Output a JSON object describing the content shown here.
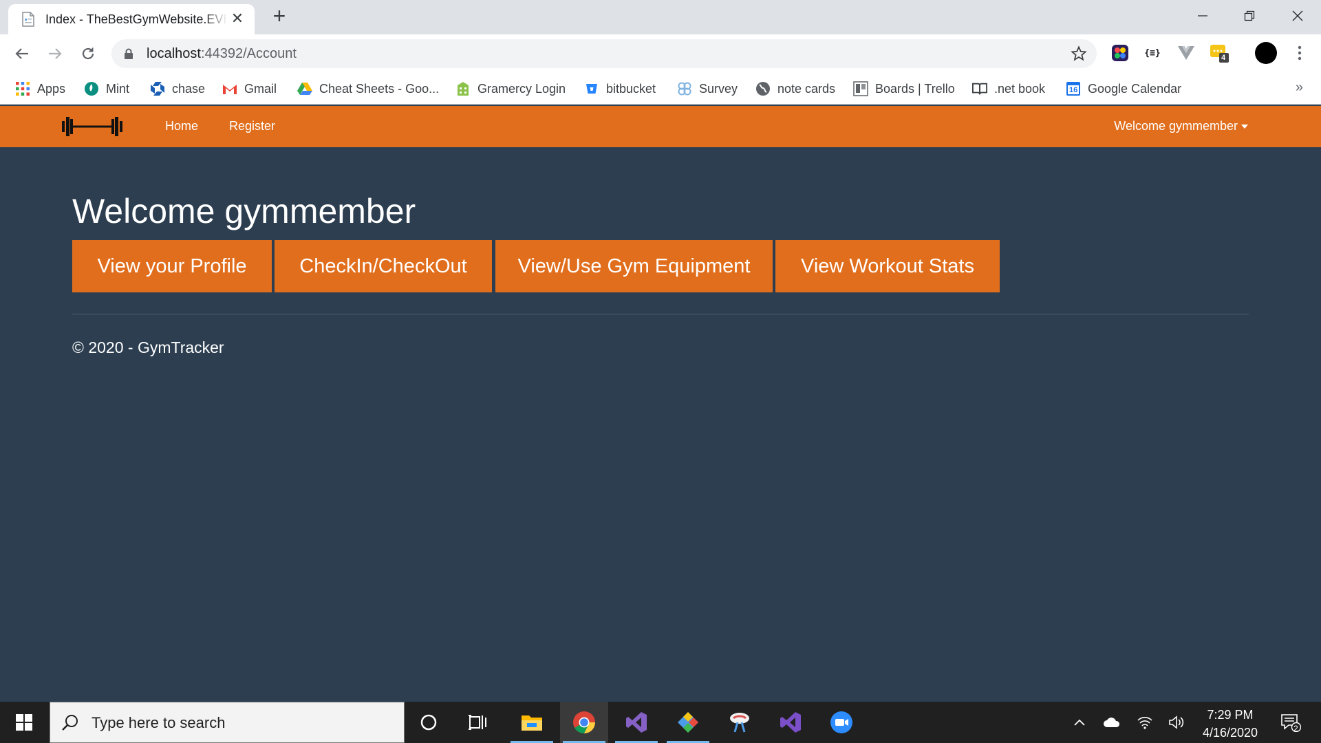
{
  "browser": {
    "tab_title": "Index - TheBestGymWebsite.EVER",
    "url_host": "localhost",
    "url_rest": ":44392/Account",
    "extension_badge": "4"
  },
  "bookmarks": [
    {
      "label": "Apps",
      "icon": "apps-grid-icon"
    },
    {
      "label": "Mint",
      "icon": "mint-icon"
    },
    {
      "label": "chase",
      "icon": "chase-icon"
    },
    {
      "label": "Gmail",
      "icon": "gmail-icon"
    },
    {
      "label": "Cheat Sheets - Goo...",
      "icon": "google-drive-icon"
    },
    {
      "label": "Gramercy Login",
      "icon": "building-icon"
    },
    {
      "label": "bitbucket",
      "icon": "bitbucket-icon"
    },
    {
      "label": "Survey",
      "icon": "survey-icon"
    },
    {
      "label": "note cards",
      "icon": "globe-icon"
    },
    {
      "label": "Boards | Trello",
      "icon": "trello-icon"
    },
    {
      "label": ".net book",
      "icon": "book-icon"
    },
    {
      "label": "Google Calendar",
      "icon": "calendar-icon",
      "badge": "16"
    }
  ],
  "navbar": {
    "links": [
      "Home",
      "Register"
    ],
    "user_menu": "Welcome gymmember"
  },
  "main": {
    "heading": "Welcome gymmember",
    "buttons": [
      "View your Profile",
      "CheckIn/CheckOut",
      "View/Use Gym Equipment",
      "View Workout Stats"
    ],
    "footer": "© 2020 - GymTracker"
  },
  "taskbar": {
    "search_placeholder": "Type here to search",
    "time": "7:29 PM",
    "date": "4/16/2020",
    "notification_count": "2"
  },
  "colors": {
    "accent_orange": "#e16e1c",
    "page_background": "#2c3e50"
  }
}
